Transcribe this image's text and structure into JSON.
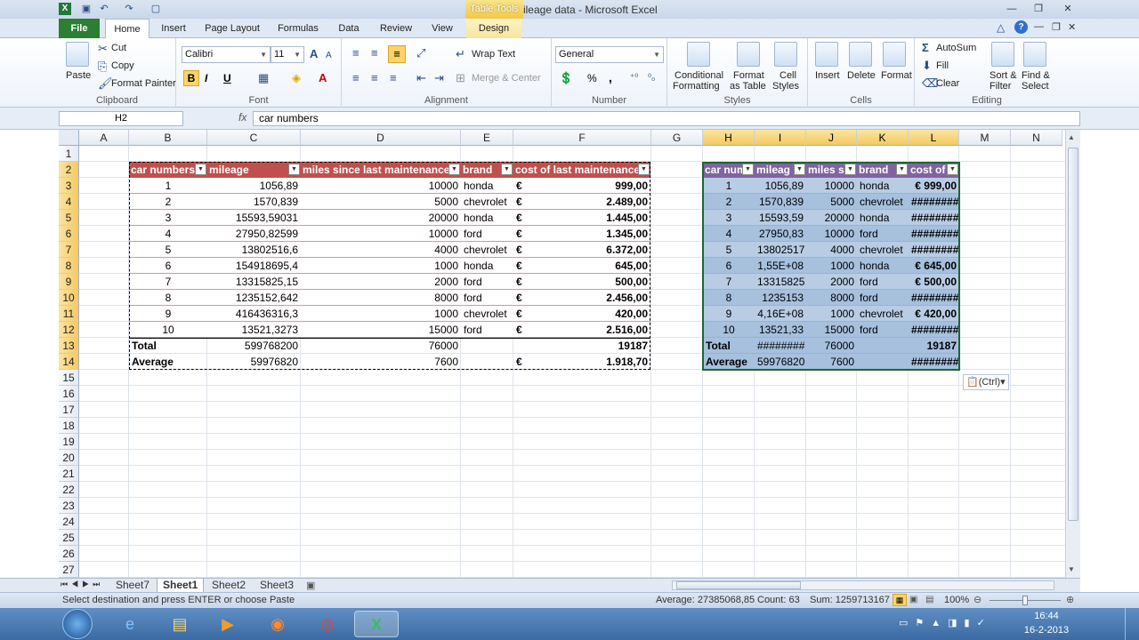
{
  "window": {
    "title": "41 car mileage data  -  Microsoft Excel",
    "contextual_tab": "Table Tools"
  },
  "tabs": [
    "File",
    "Home",
    "Insert",
    "Page Layout",
    "Formulas",
    "Data",
    "Review",
    "View",
    "Design"
  ],
  "ribbon": {
    "clipboard": {
      "paste": "Paste",
      "cut": "Cut",
      "copy": "Copy",
      "format_painter": "Format Painter",
      "label": "Clipboard"
    },
    "font": {
      "name": "Calibri",
      "size": "11",
      "label": "Font",
      "bold": "B",
      "italic": "I",
      "underline": "U"
    },
    "alignment": {
      "wrap": "Wrap Text",
      "merge": "Merge & Center",
      "label": "Alignment"
    },
    "number": {
      "format": "General",
      "label": "Number",
      "percent": "%",
      "comma": ","
    },
    "styles": {
      "conditional": "Conditional",
      "conditional2": "Formatting",
      "format_table": "Format",
      "format_table2": "as Table",
      "cell_styles": "Cell",
      "cell_styles2": "Styles",
      "label": "Styles"
    },
    "cells": {
      "insert": "Insert",
      "delete": "Delete",
      "format": "Format",
      "label": "Cells"
    },
    "editing": {
      "autosum": "AutoSum",
      "fill": "Fill",
      "clear": "Clear",
      "sort": "Sort &",
      "sort2": "Filter",
      "find": "Find &",
      "find2": "Select",
      "label": "Editing"
    }
  },
  "formula_bar": {
    "name_box": "H2",
    "fx": "fx",
    "content": "car numbers"
  },
  "columns": [
    "A",
    "B",
    "C",
    "D",
    "E",
    "F",
    "G",
    "H",
    "I",
    "J",
    "K",
    "L",
    "M",
    "N"
  ],
  "rows": [
    "1",
    "2",
    "3",
    "4",
    "5",
    "6",
    "7",
    "8",
    "9",
    "10",
    "11",
    "12",
    "13",
    "14",
    "15",
    "16",
    "17",
    "18",
    "19",
    "20",
    "21",
    "22",
    "23",
    "24",
    "25",
    "26",
    "27"
  ],
  "table_left": {
    "headers": [
      "car numbers",
      "mileage",
      "miles since last maintenance",
      "brand",
      "cost of last maintenance"
    ],
    "rows": [
      [
        "1",
        "1056,89",
        "10000",
        "honda",
        "€",
        "999,00"
      ],
      [
        "2",
        "1570,839",
        "5000",
        "chevrolet",
        "€",
        "2.489,00"
      ],
      [
        "3",
        "15593,59031",
        "20000",
        "honda",
        "€",
        "1.445,00"
      ],
      [
        "4",
        "27950,82599",
        "10000",
        "ford",
        "€",
        "1.345,00"
      ],
      [
        "5",
        "13802516,6",
        "4000",
        "chevrolet",
        "€",
        "6.372,00"
      ],
      [
        "6",
        "154918695,4",
        "1000",
        "honda",
        "€",
        "645,00"
      ],
      [
        "7",
        "13315825,15",
        "2000",
        "ford",
        "€",
        "500,00"
      ],
      [
        "8",
        "1235152,642",
        "8000",
        "ford",
        "€",
        "2.456,00"
      ],
      [
        "9",
        "416436316,3",
        "1000",
        "chevrolet",
        "€",
        "420,00"
      ],
      [
        "10",
        "13521,3273",
        "15000",
        "ford",
        "€",
        "2.516,00"
      ]
    ],
    "total": [
      "Total",
      "599768200",
      "76000",
      "",
      "",
      "19187"
    ],
    "average": [
      "Average",
      "59976820",
      "7600",
      "",
      "€",
      "1.918,70"
    ]
  },
  "table_right": {
    "headers": [
      "car num",
      "mileag",
      "miles s",
      "brand",
      "cost of"
    ],
    "rows": [
      [
        "1",
        "1056,89",
        "10000",
        "honda",
        "€ 999,00"
      ],
      [
        "2",
        "1570,839",
        "5000",
        "chevrolet",
        "########"
      ],
      [
        "3",
        "15593,59",
        "20000",
        "honda",
        "########"
      ],
      [
        "4",
        "27950,83",
        "10000",
        "ford",
        "########"
      ],
      [
        "5",
        "13802517",
        "4000",
        "chevrolet",
        "########"
      ],
      [
        "6",
        "1,55E+08",
        "1000",
        "honda",
        "€ 645,00"
      ],
      [
        "7",
        "13315825",
        "2000",
        "ford",
        "€ 500,00"
      ],
      [
        "8",
        "1235153",
        "8000",
        "ford",
        "########"
      ],
      [
        "9",
        "4,16E+08",
        "1000",
        "chevrolet",
        "€ 420,00"
      ],
      [
        "10",
        "13521,33",
        "15000",
        "ford",
        "########"
      ]
    ],
    "total": [
      "Total",
      "########",
      "76000",
      "",
      "19187"
    ],
    "average": [
      "Average",
      "59976820",
      "7600",
      "",
      "########"
    ]
  },
  "paste_options": "(Ctrl)",
  "sheets": [
    "Sheet7",
    "Sheet1",
    "Sheet2",
    "Sheet3"
  ],
  "active_sheet": "Sheet1",
  "status": {
    "message": "Select destination and press ENTER or choose Paste",
    "average": "Average: 27385068,85",
    "count": "Count: 63",
    "sum": "Sum: 1259713167",
    "zoom": "100%"
  },
  "taskbar": {
    "time": "16:44",
    "date": "16-2-2013"
  },
  "colors": {
    "header_red": "#c0504d",
    "header_purple": "#8064a2",
    "band_blue": "#b8cce4",
    "file_green": "#2b7e32"
  }
}
